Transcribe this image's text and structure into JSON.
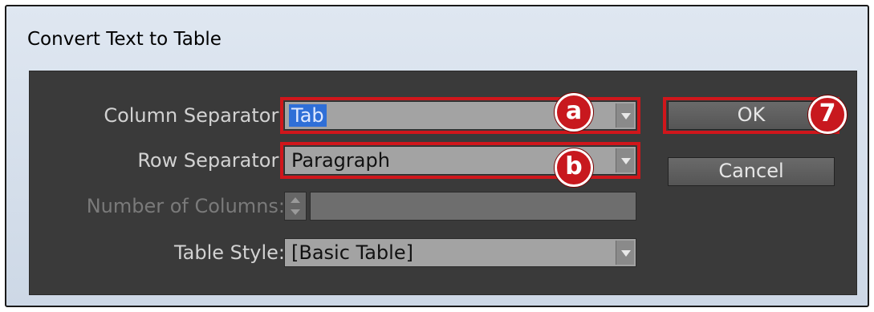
{
  "dialog": {
    "title": "Convert Text to Table"
  },
  "fields": {
    "column_separator": {
      "label": "Column Separator:",
      "value": "Tab"
    },
    "row_separator": {
      "label": "Row Separator:",
      "value": "Paragraph"
    },
    "number_of_columns": {
      "label": "Number of Columns:",
      "value": ""
    },
    "table_style": {
      "label": "Table Style:",
      "value": "[Basic Table]"
    }
  },
  "buttons": {
    "ok": "OK",
    "cancel": "Cancel"
  },
  "annotations": {
    "a": "a",
    "b": "b",
    "seven": "7"
  },
  "colors": {
    "highlight": "#d0161b",
    "panel": "#3a3a3a",
    "selection": "#2f6fd7"
  }
}
